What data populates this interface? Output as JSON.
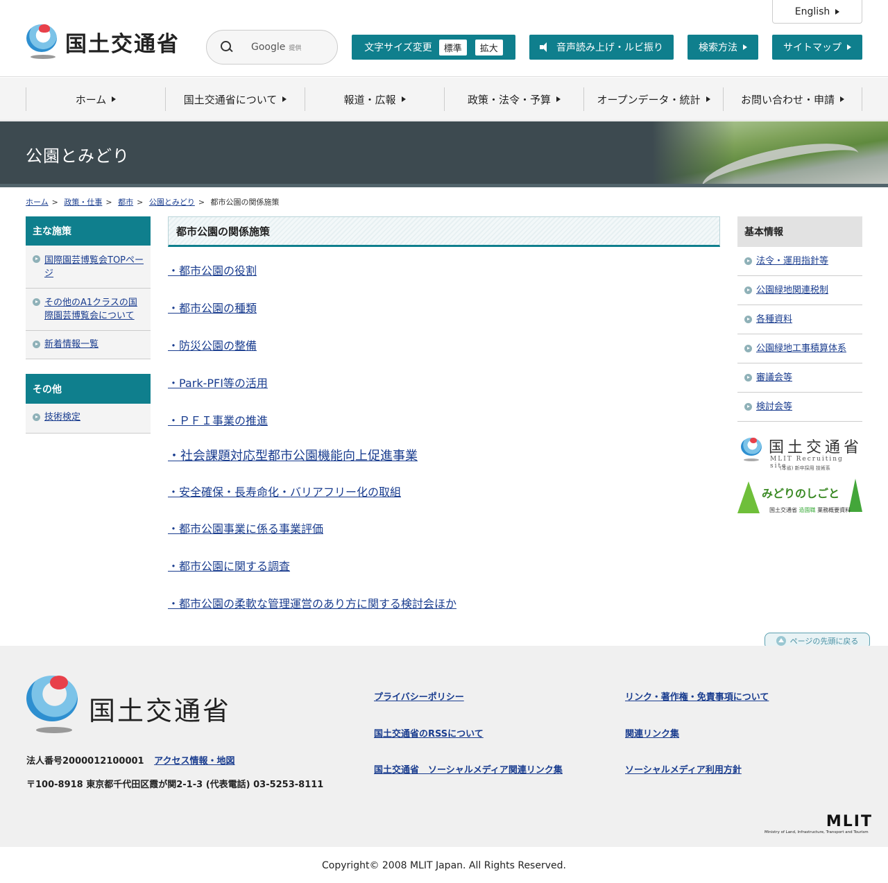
{
  "header": {
    "logo_text": "国土交通省",
    "search_brand": "Google",
    "search_provided": "提供",
    "english": "English",
    "font_size_label": "文字サイズ変更",
    "font_size_standard": "標準",
    "font_size_large": "拡大",
    "voice_label": "音声読み上げ・ルビ振り",
    "search_method": "検索方法",
    "sitemap": "サイトマップ"
  },
  "nav": [
    {
      "label": "ホーム"
    },
    {
      "label": "国土交通省について"
    },
    {
      "label": "報道・広報"
    },
    {
      "label": "政策・法令・予算"
    },
    {
      "label": "オープンデータ・統計"
    },
    {
      "label": "お問い合わせ・申請"
    }
  ],
  "hero": {
    "title": "公園とみどり"
  },
  "breadcrumb": {
    "items": [
      "ホーム",
      "政策・仕事",
      "都市",
      "公園とみどり"
    ],
    "current": "都市公園の関係施策",
    "sep": ">"
  },
  "left_sidebar": {
    "main_head": "主な施策",
    "main_items": [
      "国際園芸博覧会TOPページ",
      "その他のA1クラスの国際園芸博覧会について",
      "新着情報一覧"
    ],
    "other_head": "その他",
    "other_items": [
      "技術検定"
    ]
  },
  "main": {
    "title": "都市公園の関係施策",
    "links": [
      "・都市公園の役割",
      "・都市公園の種類",
      "・防災公園の整備",
      "・Park-PFI等の活用",
      "・ＰＦＩ事業の推進",
      "・社会課題対応型都市公園機能向上促進事業",
      "・安全確保・長寿命化・バリアフリー化の取組",
      "・都市公園事業に係る事業評価",
      "・都市公園に関する調査",
      "・都市公園の柔軟な管理運営のあり方に関する検討会ほか"
    ]
  },
  "right_sidebar": {
    "head": "基本情報",
    "items": [
      "法令・運用指針等",
      "公園緑地関連税制",
      "各種資料",
      "公園緑地工事積算体系",
      "審議会等",
      "検討会等"
    ],
    "banner_recruit": {
      "title": "国土交通省",
      "sub": "MLIT Recruiting site",
      "note": "(本省) 新卒採用 技術系"
    },
    "banner_green": {
      "title": "みどりのしごと",
      "org": "国土交通省",
      "dept": "造園職",
      "desc": "業務概要資料"
    }
  },
  "pagetop": "ページの先頭に戻る",
  "footer": {
    "logo_text": "国土交通省",
    "corp_number": "法人番号2000012100001",
    "access": "アクセス情報・地図",
    "address": "〒100-8918 東京都千代田区霞が関2-1-3 (代表電話) 03-5253-8111",
    "links_left": [
      "プライバシーポリシー",
      "国土交通省のRSSについて",
      "国土交通省　ソーシャルメディア関連リンク集"
    ],
    "links_right": [
      "リンク・著作権・免責事項について",
      "関連リンク集",
      "ソーシャルメディア利用方針"
    ],
    "mlit_logo": "MLIT",
    "mlit_sub": "Ministry of Land, Infrastructure, Transport and Tourism"
  },
  "copyright": "Copyright© 2008 MLIT Japan. All Rights Reserved.",
  "colors": {
    "teal": "#0f7f8d",
    "link": "#1a3d8f",
    "hero": "#3d4a50"
  }
}
